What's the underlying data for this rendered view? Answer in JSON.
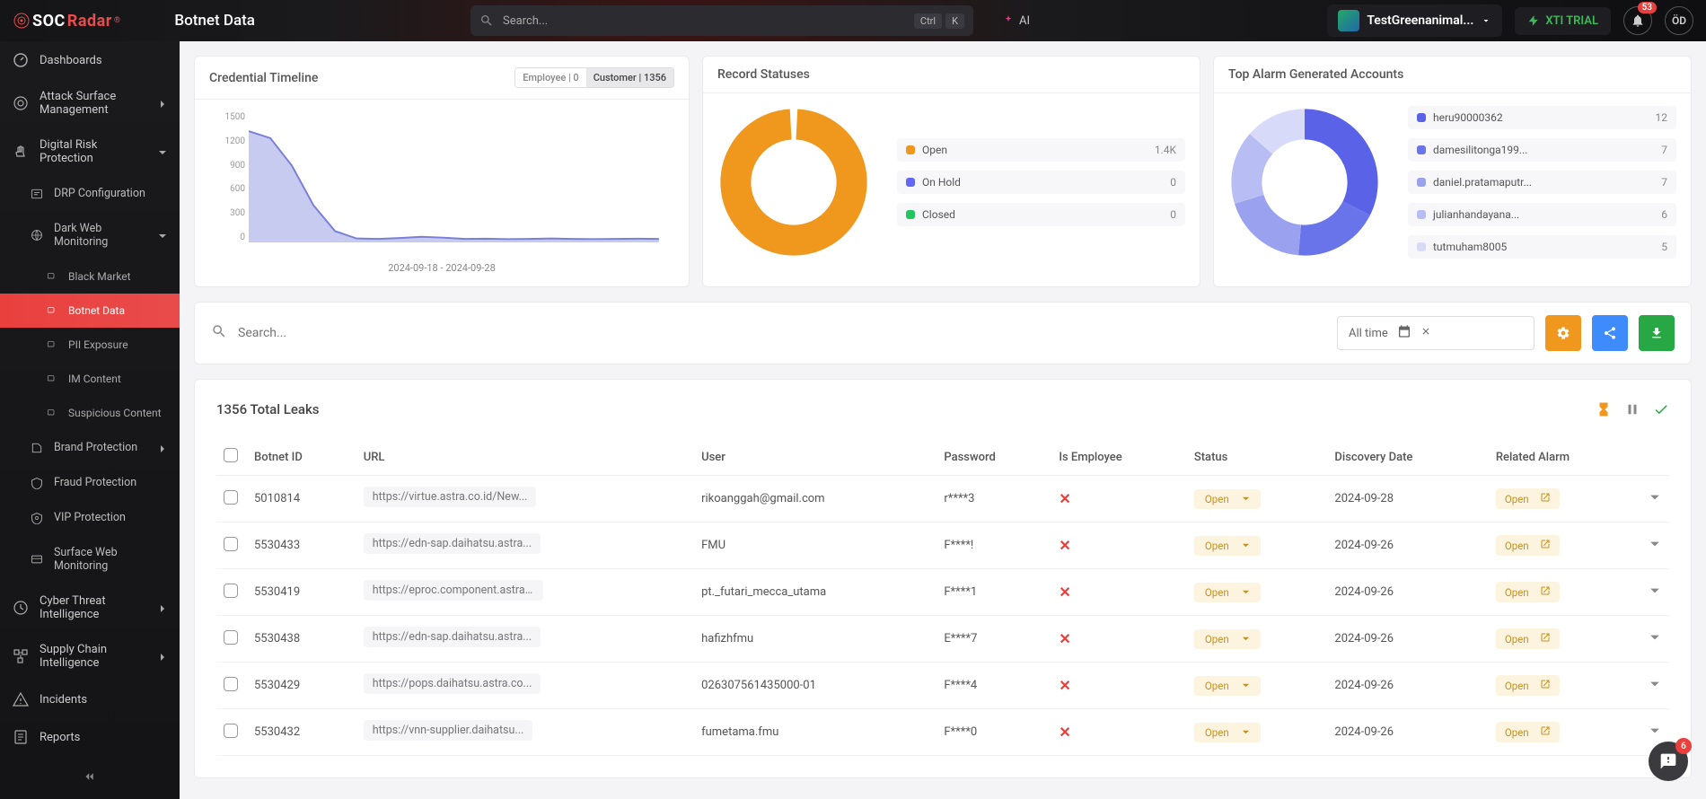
{
  "header": {
    "logo_a": "SOC",
    "logo_b": "Radar",
    "page_title": "Botnet Data",
    "search_placeholder": "Search...",
    "key_ctrl": "Ctrl",
    "key_k": "K",
    "ai": "AI",
    "company": "TestGreenanimal...",
    "xti": "XTI TRIAL",
    "bell_badge": "53",
    "user": "ÖD"
  },
  "sidebar": {
    "items": [
      {
        "label": "Dashboards",
        "icon": "gauge"
      },
      {
        "label": "Attack Surface Management",
        "icon": "target",
        "chev": "right"
      },
      {
        "label": "Digital Risk Protection",
        "icon": "hand",
        "chev": "down"
      },
      {
        "label": "DRP Configuration",
        "icon": "config",
        "sub": true
      },
      {
        "label": "Dark Web Monitoring",
        "icon": "web",
        "sub": true,
        "chev": "down"
      },
      {
        "label": "Black Market",
        "icon": "dot",
        "subsub": true
      },
      {
        "label": "Botnet Data",
        "icon": "dot",
        "subsub": true,
        "active": true
      },
      {
        "label": "PII Exposure",
        "icon": "dot",
        "subsub": true
      },
      {
        "label": "IM Content",
        "icon": "dot",
        "subsub": true
      },
      {
        "label": "Suspicious Content",
        "icon": "dot",
        "subsub": true
      },
      {
        "label": "Brand Protection",
        "icon": "brand",
        "sub": true,
        "chev": "right"
      },
      {
        "label": "Fraud Protection",
        "icon": "fraud",
        "sub": true
      },
      {
        "label": "VIP Protection",
        "icon": "vip",
        "sub": true
      },
      {
        "label": "Surface Web Monitoring",
        "icon": "surface",
        "sub": true
      },
      {
        "label": "Cyber Threat Intelligence",
        "icon": "cti",
        "chev": "right"
      },
      {
        "label": "Supply Chain Intelligence",
        "icon": "supply",
        "chev": "right"
      },
      {
        "label": "Incidents",
        "icon": "incidents"
      },
      {
        "label": "Reports",
        "icon": "reports"
      }
    ]
  },
  "cards": {
    "timeline": {
      "title": "Credential Timeline",
      "pill_emp": "Employee | 0",
      "pill_cust": "Customer | 1356",
      "x_label": "2024-09-18 - 2024-09-28"
    },
    "statuses": {
      "title": "Record Statuses",
      "items": [
        {
          "label": "Open",
          "value": "1.4K",
          "color": "#f0981e"
        },
        {
          "label": "On Hold",
          "value": "0",
          "color": "#6366f1"
        },
        {
          "label": "Closed",
          "value": "0",
          "color": "#22c55e"
        }
      ]
    },
    "accounts": {
      "title": "Top Alarm Generated Accounts",
      "items": [
        {
          "label": "heru90000362",
          "value": "12",
          "color": "#5a63e8"
        },
        {
          "label": "damesilitonga199...",
          "value": "7",
          "color": "#6a74ea"
        },
        {
          "label": "daniel.pratamaputr...",
          "value": "7",
          "color": "#9aa2f0"
        },
        {
          "label": "julianhandayana...",
          "value": "6",
          "color": "#b8bdf3"
        },
        {
          "label": "tutmuham8005",
          "value": "5",
          "color": "#d7daf8"
        }
      ]
    }
  },
  "filters": {
    "placeholder": "Search...",
    "date": "All time"
  },
  "table": {
    "title": "1356 Total Leaks",
    "cols": [
      "Botnet ID",
      "URL",
      "User",
      "Password",
      "Is Employee",
      "Status",
      "Discovery Date",
      "Related Alarm"
    ],
    "rows": [
      {
        "id": "5010814",
        "url": "https://virtue.astra.co.id/New...",
        "user": "rikoanggah@gmail.com",
        "pw": "r****3",
        "emp": false,
        "status": "Open",
        "date": "2024-09-28",
        "alarm": "Open"
      },
      {
        "id": "5530433",
        "url": "https://edn-sap.daihatsu.astra...",
        "user": "FMU",
        "pw": "F****!",
        "emp": false,
        "status": "Open",
        "date": "2024-09-26",
        "alarm": "Open"
      },
      {
        "id": "5530419",
        "url": "https://eproc.component.astra....",
        "user": "pt._futari_mecca_utama",
        "pw": "F****1",
        "emp": false,
        "status": "Open",
        "date": "2024-09-26",
        "alarm": "Open"
      },
      {
        "id": "5530438",
        "url": "https://edn-sap.daihatsu.astra...",
        "user": "hafizhfmu",
        "pw": "E****7",
        "emp": false,
        "status": "Open",
        "date": "2024-09-26",
        "alarm": "Open"
      },
      {
        "id": "5530429",
        "url": "https://pops.daihatsu.astra.co...",
        "user": "026307561435000-01",
        "pw": "F****4",
        "emp": false,
        "status": "Open",
        "date": "2024-09-26",
        "alarm": "Open"
      },
      {
        "id": "5530432",
        "url": "https://vnn-supplier.daihatsu...",
        "user": "fumetama.fmu",
        "pw": "F****0",
        "emp": false,
        "status": "Open",
        "date": "2024-09-26",
        "alarm": "Open"
      }
    ]
  },
  "help_badge": "6",
  "chart_data": [
    {
      "type": "area",
      "title": "Credential Timeline",
      "series_name": "Customer",
      "x_range": "2024-09-18 - 2024-09-28",
      "ylim": [
        0,
        1500
      ],
      "yticks": [
        0,
        300,
        600,
        900,
        1200,
        1500
      ],
      "values": [
        1280,
        1200,
        880,
        420,
        120,
        35,
        30,
        40,
        55,
        45,
        30,
        32,
        28,
        30,
        35,
        30,
        28,
        30,
        32,
        30
      ]
    },
    {
      "type": "donut",
      "title": "Record Statuses",
      "categories": [
        "Open",
        "On Hold",
        "Closed"
      ],
      "values": [
        1400,
        0,
        0
      ],
      "colors": [
        "#f0981e",
        "#6366f1",
        "#22c55e"
      ]
    },
    {
      "type": "donut",
      "title": "Top Alarm Generated Accounts",
      "categories": [
        "heru90000362",
        "damesilitonga199...",
        "daniel.pratamaputr...",
        "julianhandayana...",
        "tutmuham8005"
      ],
      "values": [
        12,
        7,
        7,
        6,
        5
      ],
      "colors": [
        "#5a63e8",
        "#6a74ea",
        "#9aa2f0",
        "#b8bdf3",
        "#d7daf8"
      ]
    }
  ]
}
